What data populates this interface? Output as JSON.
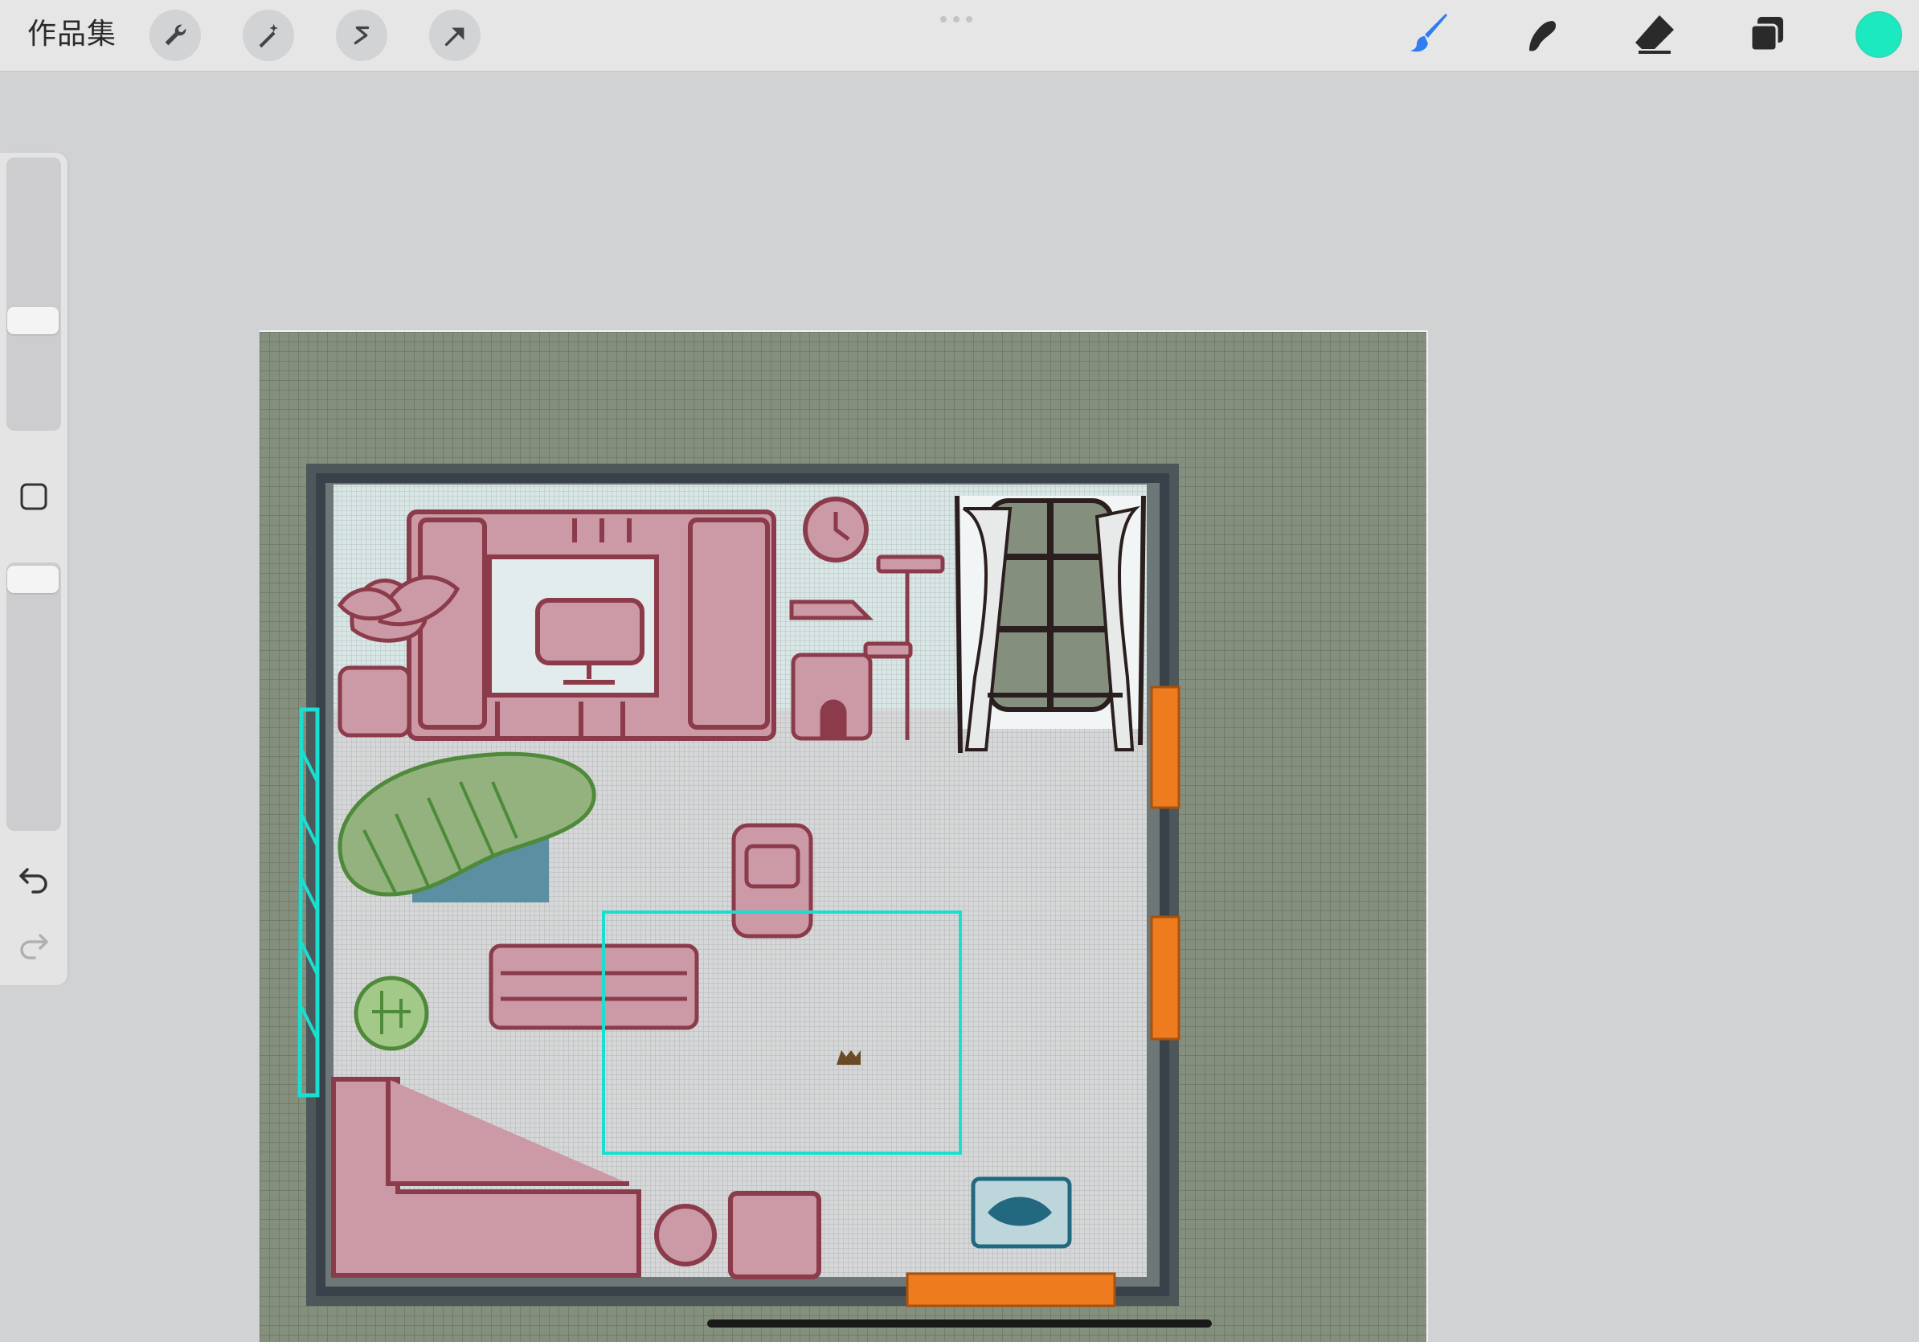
{
  "topbar": {
    "gallery_label": "作品集",
    "left_tools": [
      "wrench-icon",
      "magic-wand-icon",
      "selection-s-icon",
      "transform-arrow-icon"
    ],
    "right_tools": [
      "brush-icon",
      "smudge-icon",
      "eraser-icon",
      "layers-icon"
    ],
    "active_tool": "brush-icon",
    "current_color": "#1de9c1"
  },
  "sidebar": {
    "brush_size_slider": 0.5,
    "opacity_slider": 0.05
  },
  "colors": {
    "accent_blue": "#2f7df0",
    "canvas_bg": "#848f7e",
    "wall_pink": "#cb9aa6",
    "outline_maroon": "#8c3b4b",
    "selection_cyan": "#19dfd0",
    "marker_orange": "#ee7b1d"
  }
}
